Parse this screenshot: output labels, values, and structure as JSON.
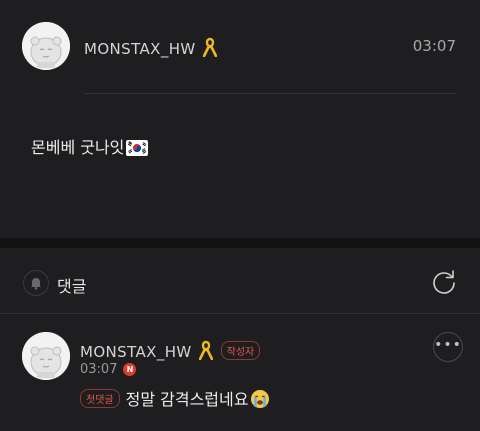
{
  "post": {
    "username": "MONSTAX_HW",
    "time": "03:07",
    "body": "몬베베 굿나잇",
    "ribbon_icon": "yellow-ribbon-icon",
    "flag_icon": "south-korea-flag-icon"
  },
  "comments_section": {
    "title": "댓글",
    "bell_icon": "bell-icon",
    "refresh_icon": "refresh-icon"
  },
  "comments": [
    {
      "username": "MONSTAX_HW",
      "author_badge": "작성자",
      "time": "03:07",
      "new_badge": "N",
      "first_badge": "첫댓글",
      "text": "정말 감격스럽네요",
      "emoji_icon": "loudly-crying-face-icon",
      "more_label": "•••"
    }
  ],
  "colors": {
    "background": "#1e1e20",
    "section_gap": "#121213",
    "badge_red": "#e05a4a",
    "new_dot": "#e03c2e",
    "ribbon_yellow": "#f2b81c"
  }
}
